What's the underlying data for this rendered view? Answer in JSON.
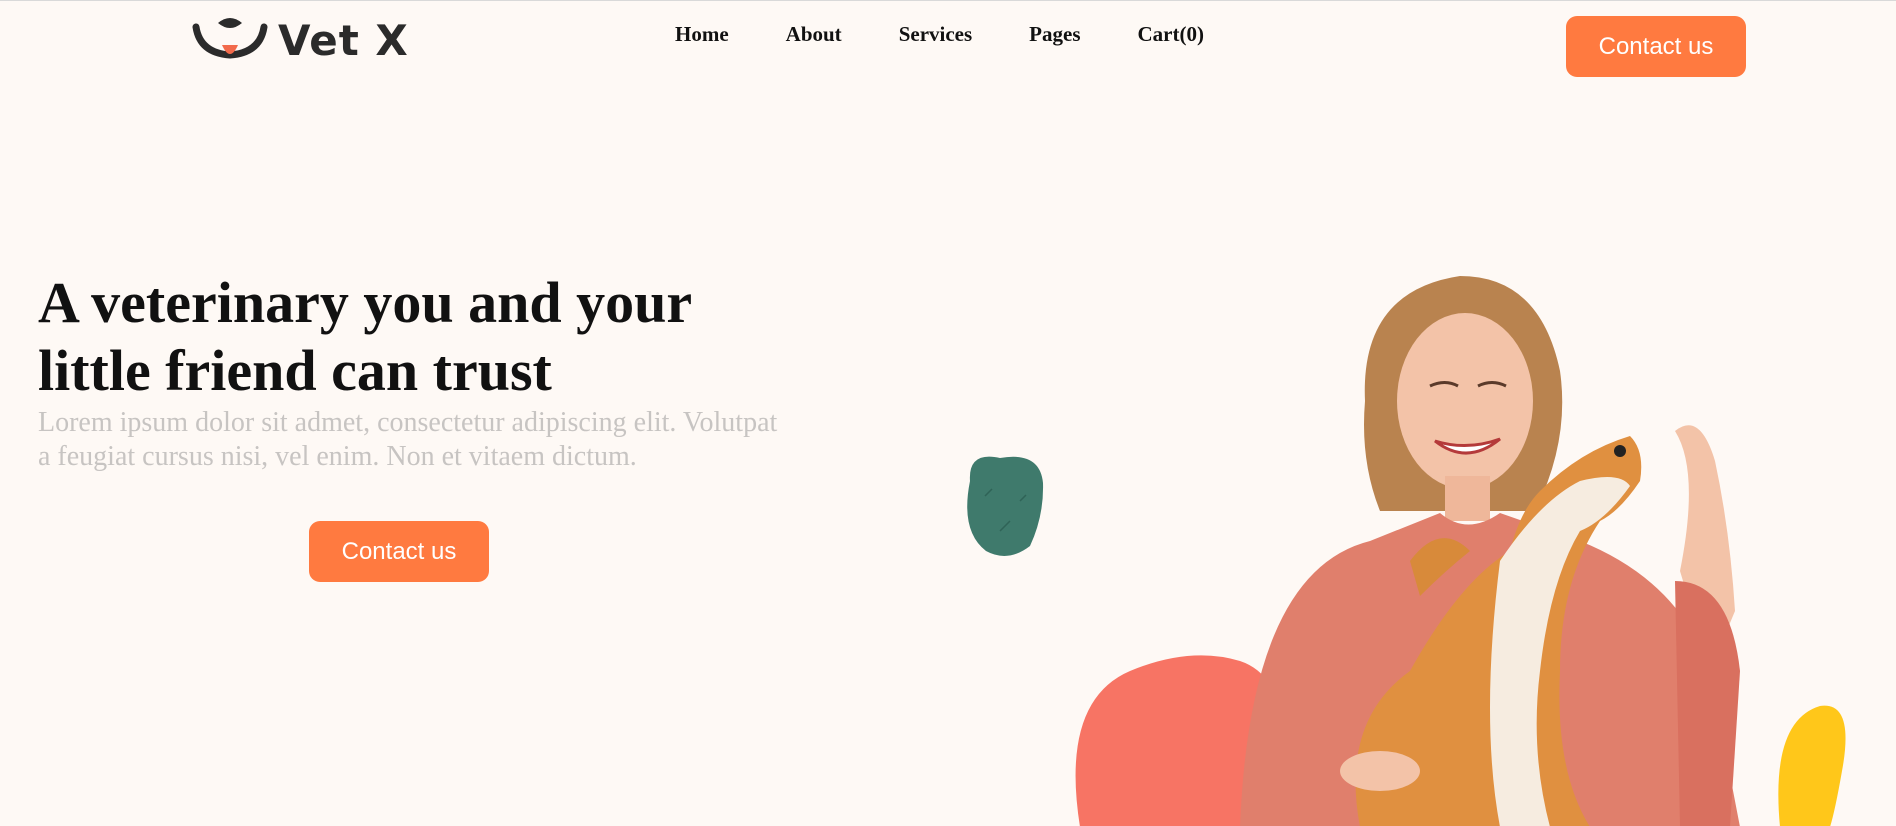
{
  "brand": {
    "name": "Vet X"
  },
  "nav": {
    "items": [
      {
        "label": "Home"
      },
      {
        "label": "About"
      },
      {
        "label": "Services"
      },
      {
        "label": "Pages"
      },
      {
        "label": "Cart(0)"
      }
    ]
  },
  "header": {
    "cta_label": "Contact us"
  },
  "hero": {
    "headline": "A veterinary you and your little friend can trust",
    "subtext": "Lorem ipsum dolor sit admet, consectetur adipiscing elit. Volutpat a feugiat cursus nisi, vel enim. Non et vitaem dictum.",
    "cta_label": "Contact us"
  },
  "colors": {
    "background": "#fef9f5",
    "accent": "#ff7a40",
    "blob_teal": "#3f7a6c",
    "blob_coral": "#f77464",
    "blob_yellow": "#ffc71a"
  },
  "icons": {
    "logo": "dog-face-logo-icon"
  }
}
